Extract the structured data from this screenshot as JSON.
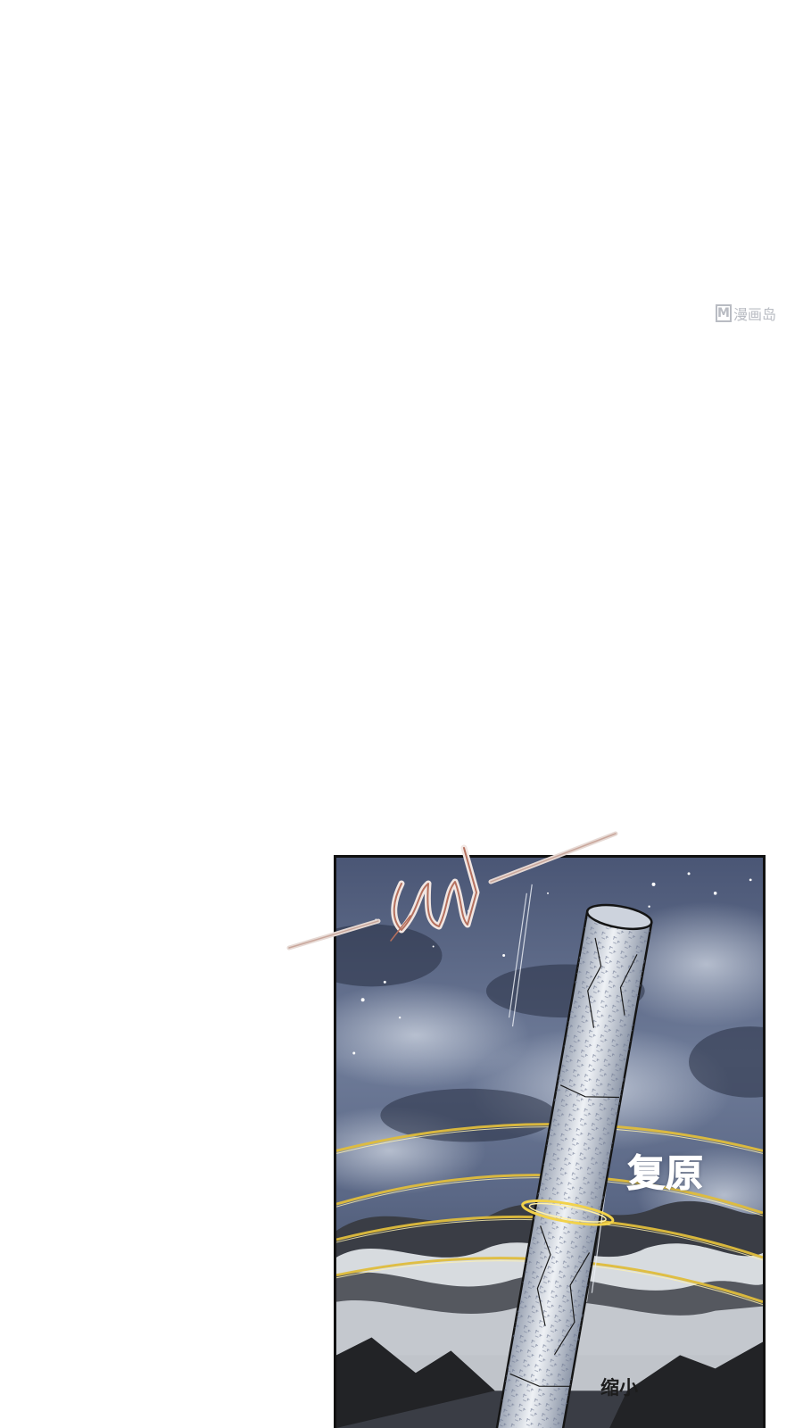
{
  "watermark": {
    "logo_letter": "M",
    "brand_text": "漫画岛"
  },
  "panel": {
    "sfx_restore": "复原",
    "sfx_shrink": "缩小"
  },
  "colors": {
    "sky_dark": "#3a4560",
    "sky_light": "#8d9ab4",
    "cloud": "#e8ebef",
    "halo": "#d9b63a",
    "pillar": "#d7dde6",
    "mountain": "#2c2c2e"
  },
  "icons": {
    "watermark": "manhua-dao-logo-icon",
    "pillar": "stone-pillar-illustration",
    "swoosh": "sound-effect-scribble"
  }
}
